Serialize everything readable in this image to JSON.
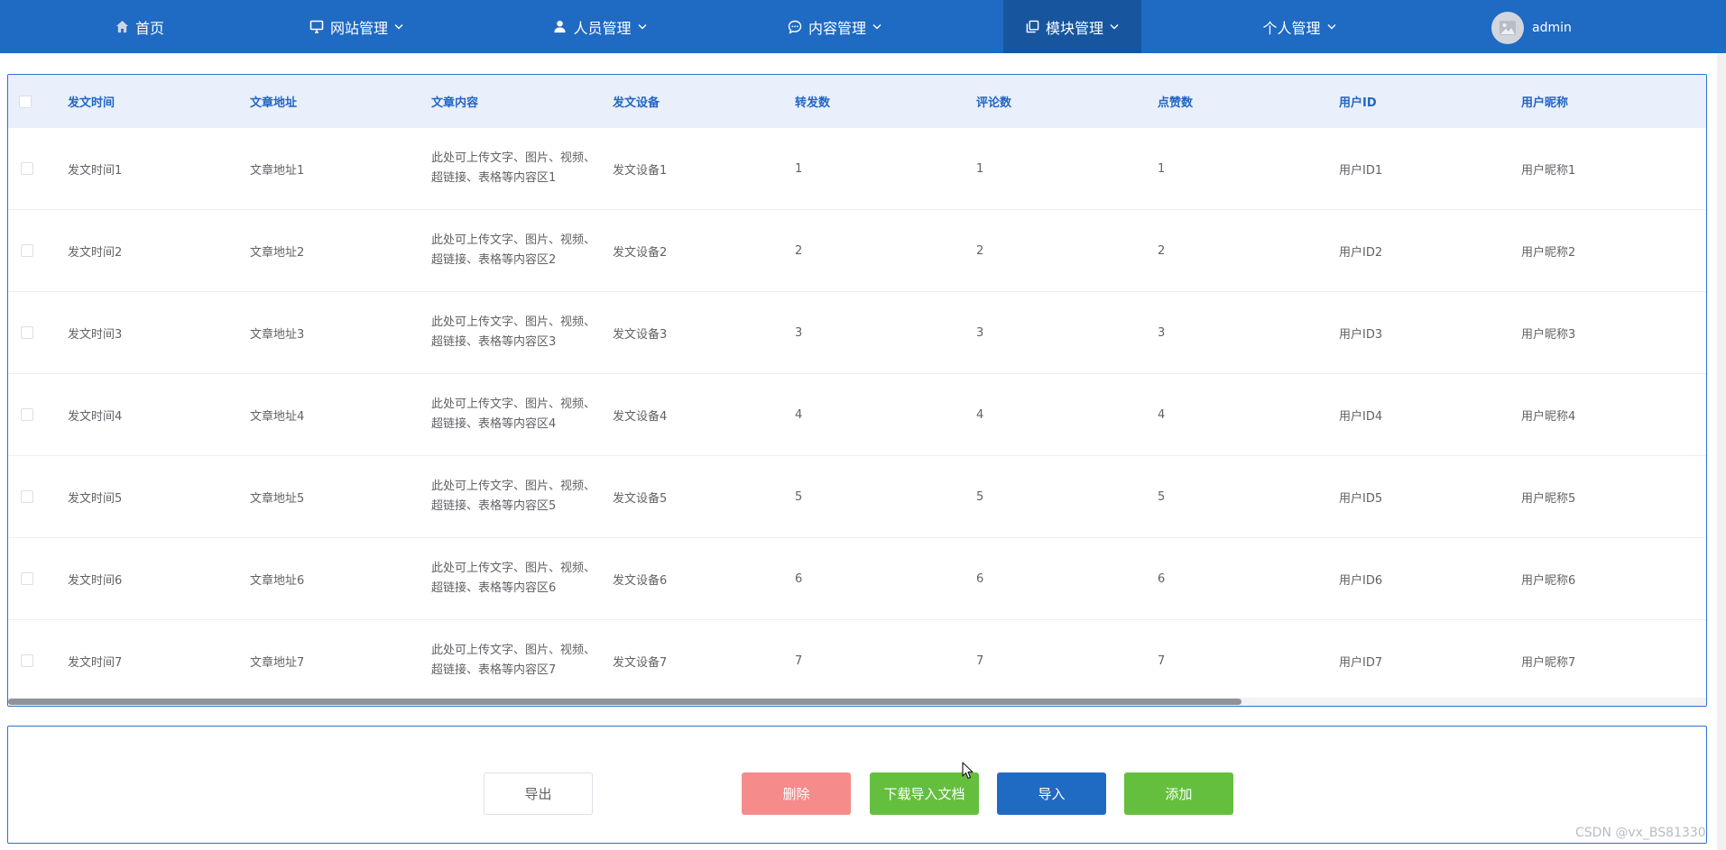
{
  "nav": {
    "home": "首页",
    "site": "网站管理",
    "people": "人员管理",
    "content": "内容管理",
    "module": "模块管理",
    "personal": "个人管理",
    "user": "admin"
  },
  "table": {
    "headers": [
      "发文时间",
      "文章地址",
      "文章内容",
      "发文设备",
      "转发数",
      "评论数",
      "点赞数",
      "用户ID",
      "用户昵称"
    ],
    "rows": [
      {
        "time": "发文时间1",
        "addr": "文章地址1",
        "content": "此处可上传文字、图片、视频、超链接、表格等内容区1",
        "device": "发文设备1",
        "forward": "1",
        "comment": "1",
        "like": "1",
        "uid": "用户ID1",
        "nick": "用户昵称1"
      },
      {
        "time": "发文时间2",
        "addr": "文章地址2",
        "content": "此处可上传文字、图片、视频、超链接、表格等内容区2",
        "device": "发文设备2",
        "forward": "2",
        "comment": "2",
        "like": "2",
        "uid": "用户ID2",
        "nick": "用户昵称2"
      },
      {
        "time": "发文时间3",
        "addr": "文章地址3",
        "content": "此处可上传文字、图片、视频、超链接、表格等内容区3",
        "device": "发文设备3",
        "forward": "3",
        "comment": "3",
        "like": "3",
        "uid": "用户ID3",
        "nick": "用户昵称3"
      },
      {
        "time": "发文时间4",
        "addr": "文章地址4",
        "content": "此处可上传文字、图片、视频、超链接、表格等内容区4",
        "device": "发文设备4",
        "forward": "4",
        "comment": "4",
        "like": "4",
        "uid": "用户ID4",
        "nick": "用户昵称4"
      },
      {
        "time": "发文时间5",
        "addr": "文章地址5",
        "content": "此处可上传文字、图片、视频、超链接、表格等内容区5",
        "device": "发文设备5",
        "forward": "5",
        "comment": "5",
        "like": "5",
        "uid": "用户ID5",
        "nick": "用户昵称5"
      },
      {
        "time": "发文时间6",
        "addr": "文章地址6",
        "content": "此处可上传文字、图片、视频、超链接、表格等内容区6",
        "device": "发文设备6",
        "forward": "6",
        "comment": "6",
        "like": "6",
        "uid": "用户ID6",
        "nick": "用户昵称6"
      },
      {
        "time": "发文时间7",
        "addr": "文章地址7",
        "content": "此处可上传文字、图片、视频、超链接、表格等内容区7",
        "device": "发文设备7",
        "forward": "7",
        "comment": "7",
        "like": "7",
        "uid": "用户ID7",
        "nick": "用户昵称7"
      }
    ]
  },
  "actions": {
    "export": "导出",
    "delete": "删除",
    "download": "下载导入文档",
    "import": "导入",
    "add": "添加"
  },
  "watermark": "CSDN @vx_BS81330",
  "colors": {
    "nav_bg": "#1f6ac2",
    "nav_active": "#17569f",
    "header_text": "#2266c4",
    "danger": "#f58b8b",
    "success": "#64bf3e"
  }
}
